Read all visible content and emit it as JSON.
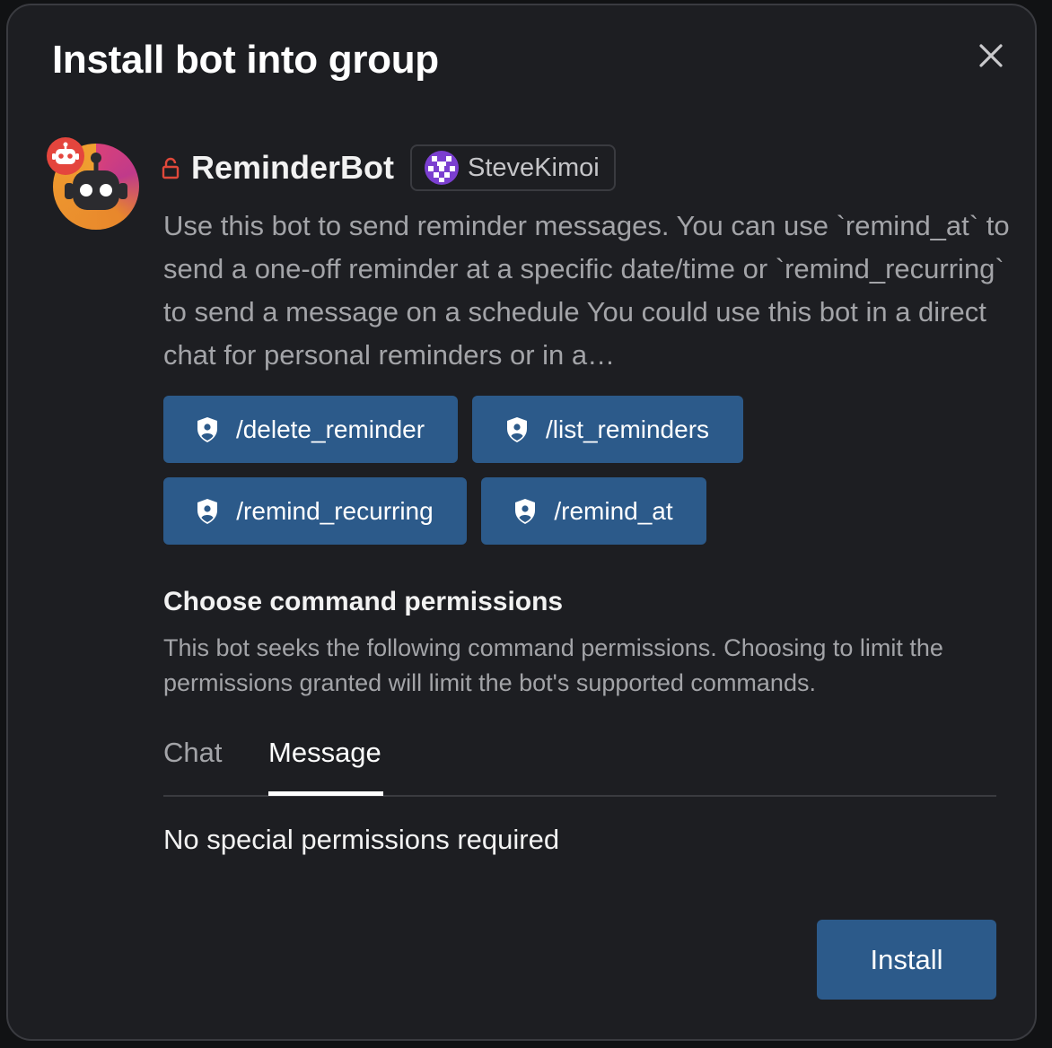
{
  "dialog": {
    "title": "Install bot into group",
    "close_icon": "close-icon"
  },
  "bot": {
    "name": "ReminderBot",
    "avatar_icon": "robot-avatar",
    "badge_icon": "robot-badge-icon",
    "lock_icon": "lock-icon",
    "owner": {
      "name": "SteveKimoi",
      "avatar_icon": "identicon-avatar"
    },
    "description": "Use this bot to send reminder messages. You can use `remind_at` to send a one-off reminder at a specific date/time or `remind_recurring` to send a message on a schedule You could use this bot in a direct chat for personal reminders or in a…"
  },
  "commands": [
    {
      "label": "/delete_reminder",
      "icon": "shield-user-icon"
    },
    {
      "label": "/list_reminders",
      "icon": "shield-user-icon"
    },
    {
      "label": "/remind_recurring",
      "icon": "shield-user-icon"
    },
    {
      "label": "/remind_at",
      "icon": "shield-user-icon"
    }
  ],
  "permissions": {
    "title": "Choose command permissions",
    "description": "This bot seeks the following command permissions. Choosing to limit the permissions granted will limit the bot's supported commands.",
    "tabs": [
      {
        "label": "Chat",
        "active": false
      },
      {
        "label": "Message",
        "active": true
      }
    ],
    "empty_text": "No special permissions required"
  },
  "actions": {
    "install_label": "Install"
  },
  "colors": {
    "background": "#1d1e22",
    "button": "#2c5a8a",
    "lock": "#e0483a",
    "badge": "#e4453d",
    "muted_text": "#a3a4a8"
  }
}
